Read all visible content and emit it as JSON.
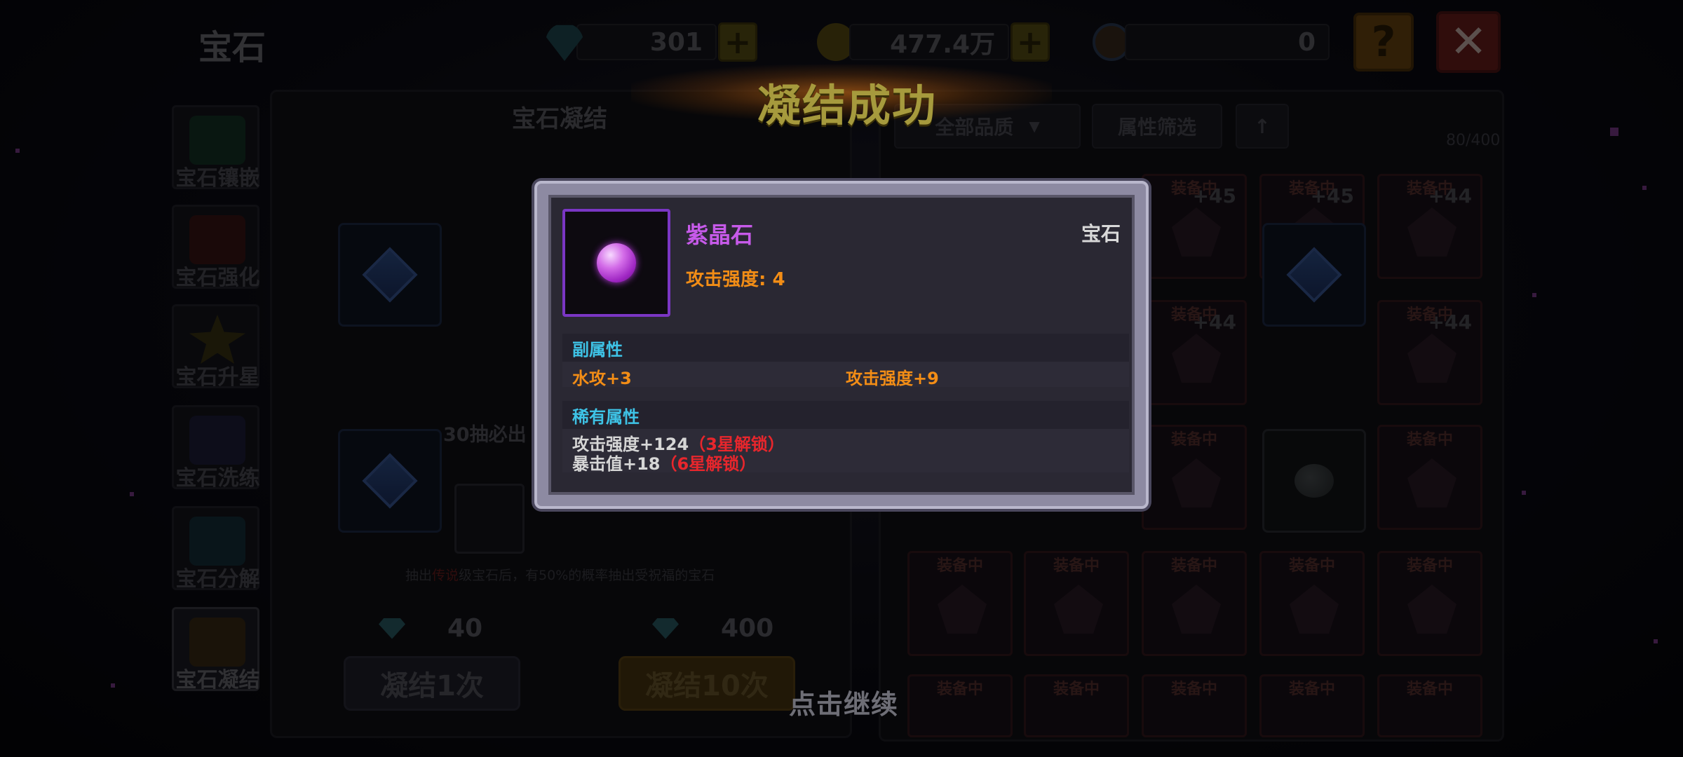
{
  "top_bar": {
    "title": "宝石",
    "diamonds": "301",
    "gold": "477.4万",
    "tokens": "0",
    "help_label": "?",
    "close_label": "✕"
  },
  "sidebar": {
    "items": [
      {
        "label": "宝石镶嵌",
        "icon": "gem-inlay-icon"
      },
      {
        "label": "宝石强化",
        "icon": "gem-enhance-icon"
      },
      {
        "label": "宝石升星",
        "icon": "gem-star-icon"
      },
      {
        "label": "宝石洗练",
        "icon": "gem-refine-icon"
      },
      {
        "label": "宝石分解",
        "icon": "gem-decompose-icon"
      },
      {
        "label": "宝石凝结",
        "icon": "gem-condense-icon"
      }
    ]
  },
  "left_panel": {
    "title": "宝石凝结",
    "guarantee_text": "30抽必出",
    "hint_prefix": "抽出",
    "hint_highlight": "传说",
    "hint_suffix": "级宝石后，有50%的概率抽出受祝福的宝石",
    "once": {
      "cost": "40",
      "label": "凝结1次"
    },
    "ten": {
      "cost": "400",
      "label": "凝结10次"
    }
  },
  "right_panel": {
    "quality_filter": "全部品质",
    "attr_filter": "属性筛选",
    "sort_label": "↑",
    "count": "80/400",
    "equipped_tag": "装备中",
    "levels": [
      "+45",
      "+45",
      "+44",
      "+44",
      "+44"
    ]
  },
  "banner": {
    "text": "凝结成功"
  },
  "dialog": {
    "item_name": "紫晶石",
    "item_type": "宝石",
    "main_stat": "攻击强度: 4",
    "sub_header": "副属性",
    "sub_stats": [
      "水攻+3",
      "攻击强度+9"
    ],
    "rare_header": "稀有属性",
    "rare_stats": [
      {
        "text": "攻击强度+124",
        "lock": "（3星解锁）"
      },
      {
        "text": "暴击值+18",
        "lock": "（6星解锁）"
      }
    ]
  },
  "continue_text": "点击继续",
  "colors": {
    "rarity_purple": "#c65ae9",
    "stat_orange": "#f28d16",
    "section_cyan": "#3ec3e6",
    "lock_red": "#e8262c"
  }
}
